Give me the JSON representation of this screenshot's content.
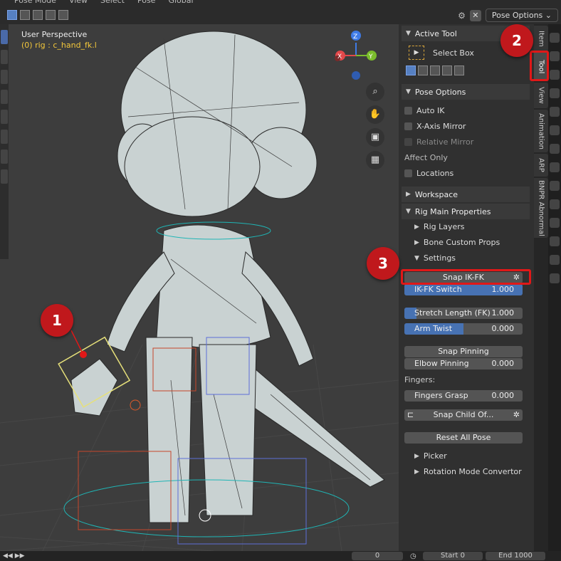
{
  "topbar": {
    "menu": [
      "Pose Mode",
      "View",
      "Select",
      "Pose"
    ],
    "transform": "Global",
    "pose_options": "Pose Options",
    "close": "✕"
  },
  "viewport": {
    "title": "User Perspective",
    "subtitle": "(0) rig : c_hand_fk.l",
    "gizmo": {
      "z": "Z",
      "x": "X",
      "y": "Y"
    }
  },
  "sidebar": {
    "active_tool": {
      "header": "Active Tool",
      "tool": "Select Box"
    },
    "pose_options": {
      "header": "Pose Options",
      "auto_ik": "Auto IK",
      "x_axis_mirror": "X-Axis Mirror",
      "relative_mirror": "Relative Mirror",
      "affect_only": "Affect Only",
      "locations": "Locations"
    },
    "workspace": "Workspace",
    "rig_main": {
      "header": "Rig Main Properties",
      "rig_layers": "Rig Layers",
      "bone_custom_props": "Bone Custom Props",
      "settings": "Settings",
      "snap_ikfk": "Snap IK-FK",
      "ikfk_switch": {
        "label": "IK-FK Switch",
        "value": "1.000",
        "fill": 1.0
      },
      "stretch_length": {
        "label": "Stretch Length (FK)",
        "value": "1.000",
        "fill": 0.1
      },
      "arm_twist": {
        "label": "Arm Twist",
        "value": "0.000",
        "fill": 0.5
      },
      "snap_pinning": "Snap Pinning",
      "elbow_pinning": {
        "label": "Elbow Pinning",
        "value": "0.000"
      },
      "fingers_label": "Fingers:",
      "fingers_grasp": {
        "label": "Fingers Grasp",
        "value": "0.000"
      },
      "snap_child_of": "Snap Child Of...",
      "reset_all_pose": "Reset All Pose",
      "picker": "Picker",
      "rotation_mode": "Rotation Mode Convertor"
    }
  },
  "tabs": [
    "Item",
    "Tool",
    "View",
    "Animation",
    "ARP",
    "BNPR Abnormal"
  ],
  "timeline": {
    "frame": "0",
    "start_label": "Start",
    "start_value": "0",
    "end_label": "End",
    "end_value": "1000"
  },
  "markers": [
    "1",
    "2",
    "3"
  ]
}
